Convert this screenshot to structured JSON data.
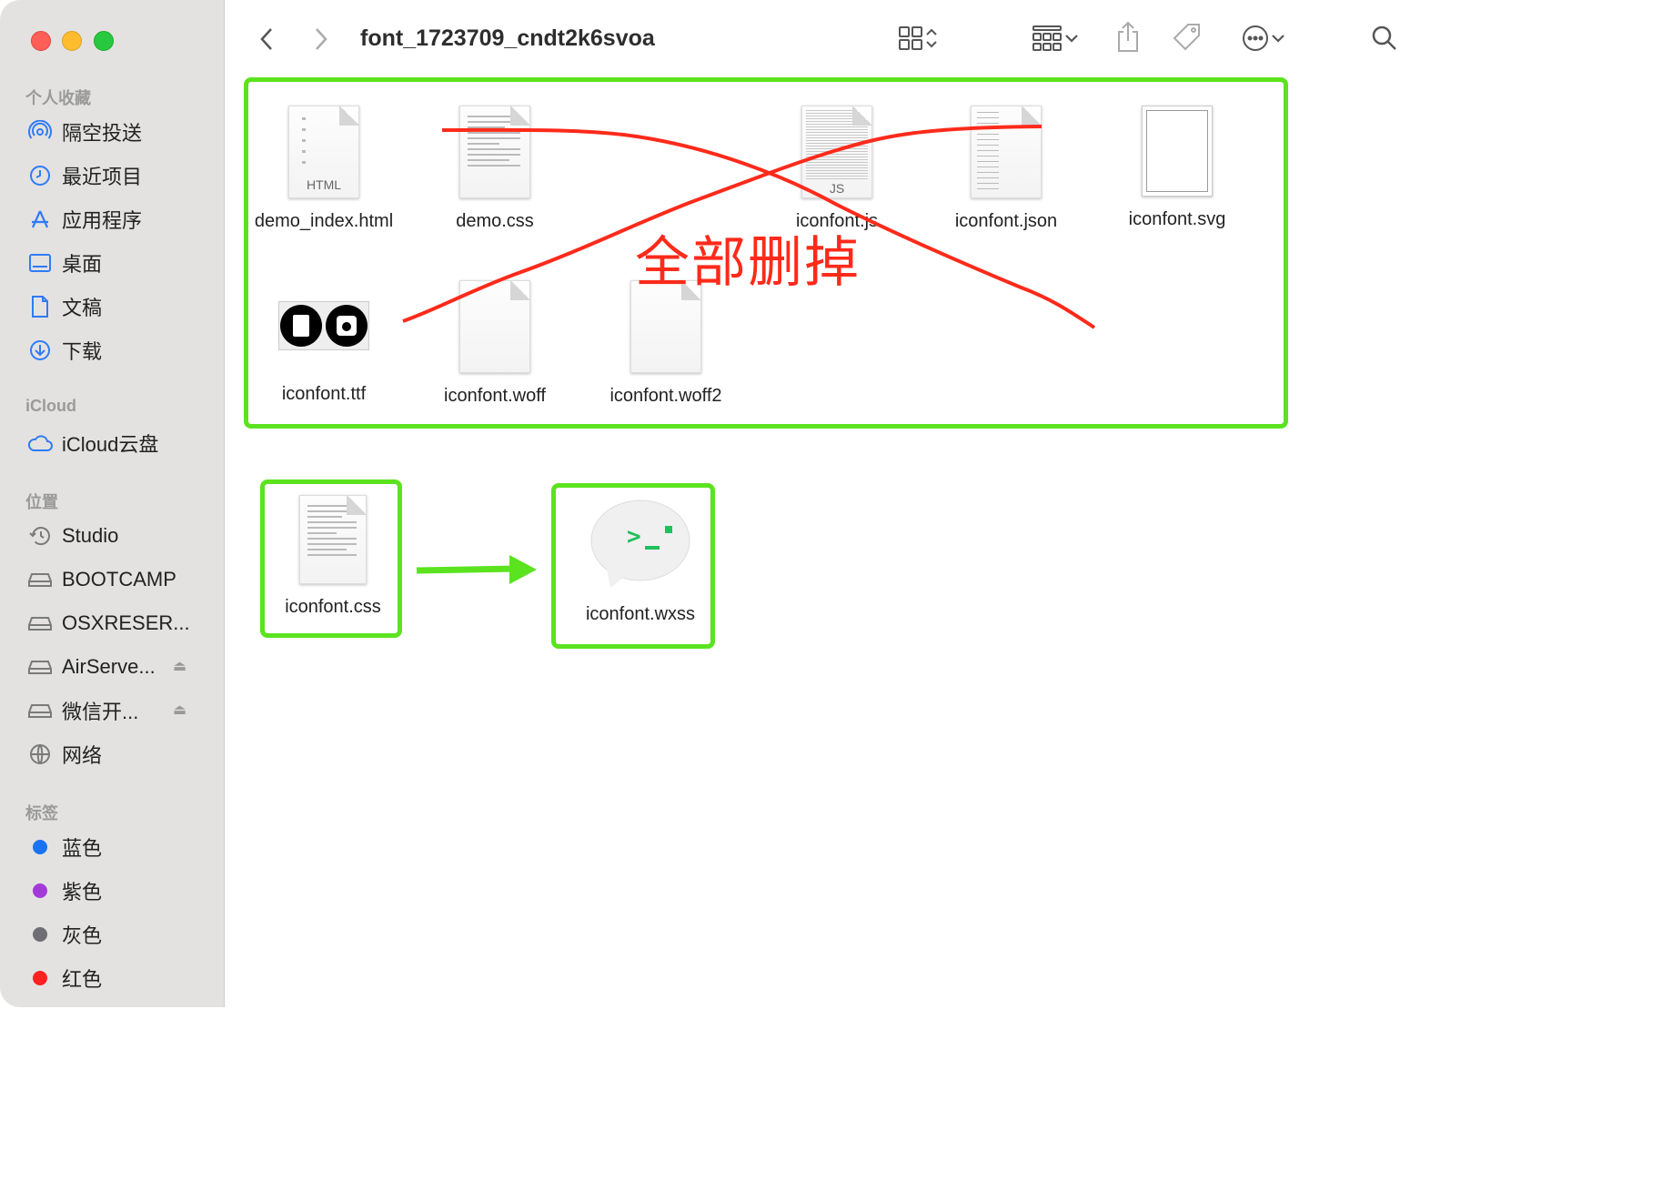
{
  "window": {
    "title": "font_1723709_cndt2k6svoa"
  },
  "sidebar": {
    "sections": [
      {
        "label": "个人收藏"
      },
      {
        "label": "iCloud"
      },
      {
        "label": "位置"
      },
      {
        "label": "标签"
      }
    ],
    "favorites": [
      {
        "label": "隔空投送",
        "icon": "airdrop-icon"
      },
      {
        "label": "最近项目",
        "icon": "clock-icon"
      },
      {
        "label": "应用程序",
        "icon": "applications-icon"
      },
      {
        "label": "桌面",
        "icon": "desktop-icon"
      },
      {
        "label": "文稿",
        "icon": "document-icon"
      },
      {
        "label": "下载",
        "icon": "download-icon"
      }
    ],
    "icloud": [
      {
        "label": "iCloud云盘",
        "icon": "cloud-icon"
      }
    ],
    "locations": [
      {
        "label": "Studio",
        "icon": "time-machine-icon"
      },
      {
        "label": "BOOTCAMP",
        "icon": "drive-icon"
      },
      {
        "label": "OSXRESER...",
        "icon": "drive-icon"
      },
      {
        "label": "AirServe...",
        "icon": "drive-icon",
        "eject": "⏏"
      },
      {
        "label": "微信开...",
        "icon": "drive-icon",
        "eject": "⏏"
      },
      {
        "label": "网络",
        "icon": "network-icon"
      }
    ],
    "tags": [
      {
        "label": "蓝色",
        "color": "#1a73f0"
      },
      {
        "label": "紫色",
        "color": "#a33ad8"
      },
      {
        "label": "灰色",
        "color": "#6e6e73"
      },
      {
        "label": "红色",
        "color": "#ff2020"
      }
    ]
  },
  "files": {
    "top": [
      {
        "name": "demo_index.html",
        "kind": "html",
        "badge": "HTML"
      },
      {
        "name": "demo.css",
        "kind": "text"
      },
      {
        "name": "iconfont.js",
        "kind": "js",
        "badge": "JS"
      },
      {
        "name": "iconfont.json",
        "kind": "json"
      },
      {
        "name": "iconfont.svg",
        "kind": "svg"
      },
      {
        "name": "iconfont.ttf",
        "kind": "ttf"
      },
      {
        "name": "iconfont.woff",
        "kind": "blank"
      },
      {
        "name": "iconfont.woff2",
        "kind": "blank"
      }
    ],
    "bottom": [
      {
        "name": "iconfont.css",
        "kind": "text"
      },
      {
        "name": "iconfont.wxss",
        "kind": "wxss"
      }
    ]
  },
  "annotations": {
    "delete_all_text": "全部删掉",
    "cross_color": "#ff2a1a",
    "box_color": "#5be31f"
  }
}
